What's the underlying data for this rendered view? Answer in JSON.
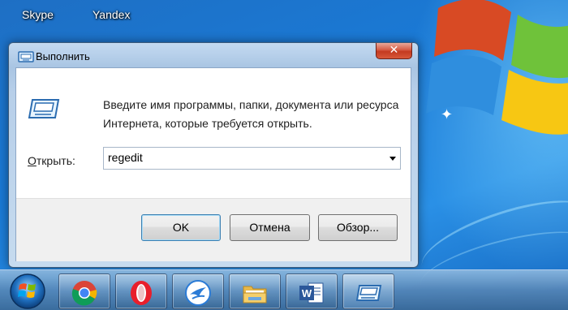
{
  "desktop": {
    "icons": [
      {
        "label": "Skype"
      },
      {
        "label": "Yandex"
      }
    ]
  },
  "run_dialog": {
    "title": "Выполнить",
    "close_label": "✕",
    "description": "Введите имя программы, папки, документа или ресурса Интернета, которые требуется открыть.",
    "open_label_accel": "О",
    "open_label_rest": "ткрыть:",
    "command_value": "regedit",
    "ok_label": "OK",
    "cancel_label": "Отмена",
    "browse_label": "Обзор..."
  },
  "taskbar": {
    "items": [
      {
        "icon": "chrome-icon"
      },
      {
        "icon": "opera-icon"
      },
      {
        "icon": "app-swift-icon"
      },
      {
        "icon": "file-explorer-icon"
      },
      {
        "icon": "word-icon"
      },
      {
        "icon": "run-icon",
        "active": true
      }
    ]
  },
  "colors": {
    "desktop_bg": "#1a7ad6",
    "close_red": "#c43a20",
    "ok_border": "#3c7fb1"
  }
}
